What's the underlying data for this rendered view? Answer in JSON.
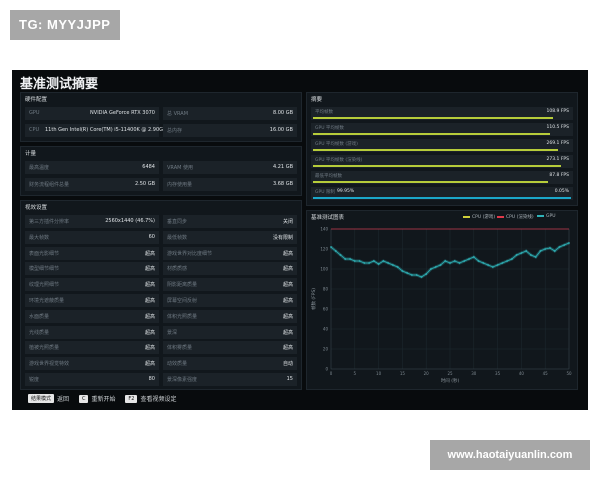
{
  "watermark_top": "TG: MYYJJPP",
  "watermark_bottom": "www.haotaiyuanlin.com",
  "title": "基准测试摘要",
  "hardware": {
    "title": "硬件配置",
    "gpu_label": "GPU",
    "gpu_value": "NVIDIA GeForce RTX 3070",
    "vram_label": "总 VRAM",
    "vram_value": "8.00 GB",
    "cpu_label": "CPU",
    "cpu_value": "11th Gen Intel(R) Core(TM) i5-11400K @ 2.90GHz",
    "mem_label": "总内存",
    "mem_value": "16.00 GB"
  },
  "memory": {
    "title": "计量",
    "r1_label": "最高温度",
    "r1_value": "6484",
    "r2_label": "VRAM 使用",
    "r2_value": "4.21 GB",
    "r3_label": "财务流程组件总量",
    "r3_value": "2.50 GB",
    "r4_label": "内存使用量",
    "r4_value": "3.68 GB"
  },
  "settings": {
    "title": "视效设置",
    "left": [
      {
        "label": "第三方插件分辨率",
        "value": "2560x1440 (46.7%)"
      },
      {
        "label": "最大帧数",
        "value": "60"
      },
      {
        "label": "表面光影细节",
        "value": "超高"
      },
      {
        "label": "模型细节细节",
        "value": "超高"
      },
      {
        "label": "纹理光照细节",
        "value": "超高"
      },
      {
        "label": "环境光遮蔽质量",
        "value": "超高"
      },
      {
        "label": "水面质量",
        "value": "超高"
      },
      {
        "label": "光线质量",
        "value": "超高"
      },
      {
        "label": "植被光照质量",
        "value": "超高"
      },
      {
        "label": "游戏世界视觉特效",
        "value": "超高"
      },
      {
        "label": "锐度",
        "value": "80"
      }
    ],
    "right": [
      {
        "label": "垂直同步",
        "value": "关闭"
      },
      {
        "label": "最低帧数",
        "value": "没有限制"
      },
      {
        "label": "游戏世界对比度细节",
        "value": "超高"
      },
      {
        "label": "材质质感",
        "value": "超高"
      },
      {
        "label": "阴影距离质量",
        "value": "超高"
      },
      {
        "label": "屏幕空间反射",
        "value": "超高"
      },
      {
        "label": "体积光照质量",
        "value": "超高"
      },
      {
        "label": "景深",
        "value": "超高"
      },
      {
        "label": "体积雾质量",
        "value": "超高"
      },
      {
        "label": "动效质量",
        "value": "自动"
      },
      {
        "label": "景深像素强度",
        "value": "15"
      }
    ]
  },
  "summary": {
    "title": "摘要",
    "rows": [
      {
        "label": "平均帧数",
        "value": "108.9 FPS",
        "color": "#b6cc3a",
        "fill": 0.93
      },
      {
        "label": "GPU 平均帧数",
        "value": "110.5 FPS",
        "color": "#b6cc3a",
        "fill": 0.92
      },
      {
        "label": "GPU 平均帧数 (游戏)",
        "value": "269.1 FPS",
        "color": "#b6cc3a",
        "fill": 0.95
      },
      {
        "label": "GPU 平均帧数 (渲染线)",
        "value": "273.1 FPS",
        "color": "#b6cc3a",
        "fill": 0.96
      },
      {
        "label": "最低平均帧数",
        "value": "87.8 FPS",
        "color": "#b6cc3a",
        "fill": 0.91
      },
      {
        "label": "GPU 限制",
        "value": "99.95%",
        "value2": "0.05%",
        "color": "#1ba7c9",
        "fill": 1.0
      }
    ]
  },
  "chart_panel_title": "基准测试图表",
  "chart_data": {
    "type": "line",
    "title": "基准测试图表",
    "xlabel": "时间 (秒)",
    "ylabel": "帧数 (FPS)",
    "xlim": [
      0,
      50
    ],
    "ylim": [
      0,
      140
    ],
    "x_ticks": [
      0,
      5,
      10,
      15,
      20,
      25,
      30,
      35,
      40,
      45,
      50
    ],
    "y_ticks": [
      0,
      20,
      40,
      60,
      80,
      100,
      120,
      140
    ],
    "legend_position": "top-right",
    "series": [
      {
        "name": "CPU (游戏)",
        "color": "#cfcf3a",
        "values": []
      },
      {
        "name": "CPU (渲染线)",
        "color": "#e0394a",
        "values": []
      },
      {
        "name": "GPU",
        "color": "#2fb3b8",
        "x": [
          0,
          1,
          2,
          3,
          4,
          5,
          6,
          7,
          8,
          9,
          10,
          11,
          12,
          13,
          14,
          15,
          16,
          17,
          18,
          19,
          20,
          21,
          22,
          23,
          24,
          25,
          26,
          27,
          28,
          29,
          30,
          31,
          32,
          33,
          34,
          35,
          36,
          37,
          38,
          39,
          40,
          41,
          42,
          43,
          44,
          45,
          46,
          47,
          48,
          49,
          50
        ],
        "values": [
          122,
          118,
          114,
          110,
          110,
          108,
          108,
          106,
          106,
          108,
          105,
          108,
          106,
          104,
          102,
          98,
          96,
          94,
          94,
          92,
          95,
          100,
          102,
          104,
          108,
          106,
          108,
          106,
          108,
          110,
          112,
          108,
          106,
          104,
          102,
          104,
          106,
          108,
          110,
          114,
          116,
          118,
          114,
          112,
          118,
          120,
          121,
          118,
          122,
          124,
          126
        ]
      }
    ]
  },
  "footer": {
    "key1": "结果模式",
    "label1": "返回",
    "key2": "C",
    "label2": "重新开始",
    "key3": "F2",
    "label3": "查看视频设定"
  }
}
